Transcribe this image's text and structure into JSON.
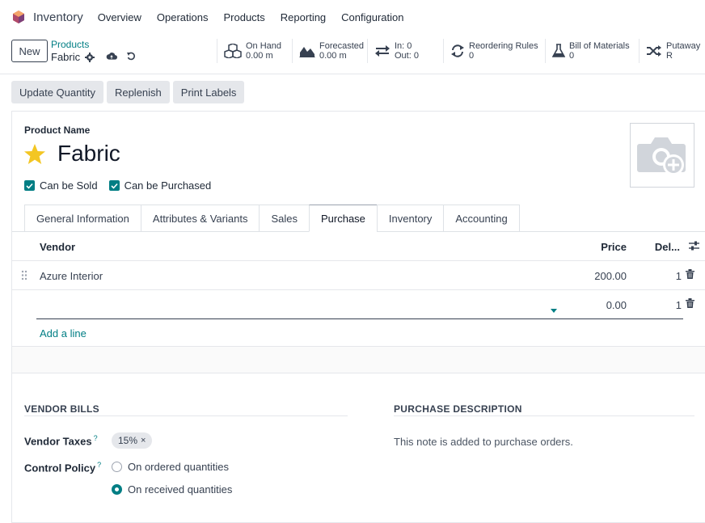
{
  "navbar": {
    "app_name": "Inventory",
    "menu": [
      "Overview",
      "Operations",
      "Products",
      "Reporting",
      "Configuration"
    ]
  },
  "control_panel": {
    "new_label": "New",
    "breadcrumb": "Products",
    "record_name": "Fabric",
    "stats": [
      {
        "icon": "cubes-icon",
        "line1": "On Hand",
        "line2": "0.00 m"
      },
      {
        "icon": "area-chart-icon",
        "line1": "Forecasted",
        "line2": "0.00 m"
      },
      {
        "icon": "exchange-icon",
        "line1": "In: 0",
        "line2": "Out: 0"
      },
      {
        "icon": "refresh-icon",
        "line1": "Reordering Rules",
        "line2": "0"
      },
      {
        "icon": "flask-icon",
        "line1": "Bill of Materials",
        "line2": "0"
      },
      {
        "icon": "random-icon",
        "line1": "Putaway R",
        "line2": ""
      }
    ]
  },
  "actions": [
    "Update Quantity",
    "Replenish",
    "Print Labels"
  ],
  "form": {
    "name_label": "Product Name",
    "name": "Fabric",
    "checkboxes": [
      "Can be Sold",
      "Can be Purchased"
    ],
    "tabs": [
      "General Information",
      "Attributes & Variants",
      "Sales",
      "Purchase",
      "Inventory",
      "Accounting"
    ],
    "active_tab": "Purchase",
    "vendor_table": {
      "columns": {
        "vendor": "Vendor",
        "price": "Price",
        "delivery": "Del..."
      },
      "rows": [
        {
          "vendor": "Azure Interior",
          "price": "200.00",
          "delivery": "1"
        },
        {
          "vendor": "",
          "price": "0.00",
          "delivery": "1"
        }
      ],
      "add_line": "Add a line"
    },
    "vendor_bills": {
      "title": "VENDOR BILLS",
      "taxes_label": "Vendor Taxes",
      "tax_tag": "15%",
      "control_policy_label": "Control Policy",
      "policy_options": [
        "On ordered quantities",
        "On received quantities"
      ],
      "selected_policy": "On received quantities"
    },
    "purchase_description": {
      "title": "PURCHASE DESCRIPTION",
      "placeholder": "This note is added to purchase orders."
    }
  },
  "colors": {
    "accent": "#017e84",
    "star": "#f3c623"
  }
}
